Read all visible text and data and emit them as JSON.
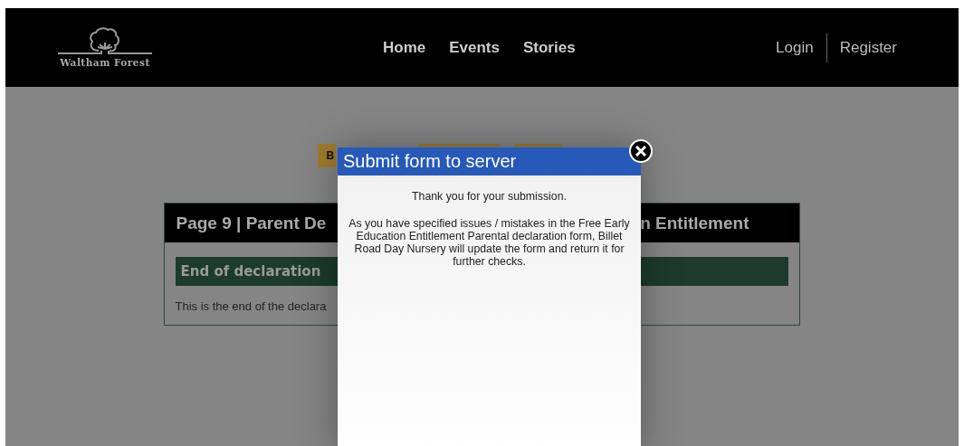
{
  "header": {
    "logo_text": "Waltham Forest",
    "nav": [
      {
        "label": "Home"
      },
      {
        "label": "Events"
      },
      {
        "label": "Stories"
      }
    ],
    "auth": [
      {
        "label": "Login"
      },
      {
        "label": "Register"
      }
    ]
  },
  "buttons": [
    {
      "kind": "labelled",
      "label": "B"
    },
    {
      "kind": "blank"
    },
    {
      "kind": "blank"
    }
  ],
  "card": {
    "title_left": "Page 9 | Parent De",
    "title_right": "n Entitlement",
    "section": "End of declaration",
    "text": "This is the end of the declara"
  },
  "modal": {
    "title": "Submit form to server",
    "message": "Thank you for your submission.",
    "detail": "As you have specified issues / mistakes in the Free Early Education Entitlement Parental declaration form, Billet Road Day Nursery will update the form and return it for further checks."
  }
}
